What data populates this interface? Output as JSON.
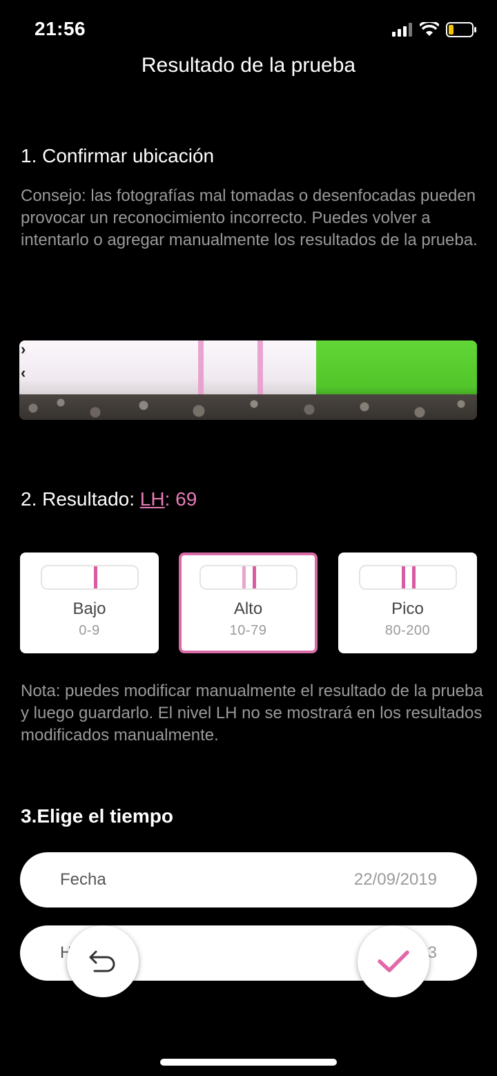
{
  "status_bar": {
    "time": "21:56",
    "signal_icon": "signal-icon",
    "wifi_icon": "wifi-icon",
    "battery_icon": "battery-icon",
    "battery_color": "#f5c400"
  },
  "header": {
    "title": "Resultado de la prueba"
  },
  "step1": {
    "title": "1. Confirmar ubicación",
    "tip": "Consejo: las fotografías mal tomadas o desenfocadas pueden provocar un reconocimiento incorrecto. Puedes volver a intentarlo o agregar manualmente los resultados de la prueba."
  },
  "step2": {
    "title_prefix": "2. Resultado: ",
    "lh_label": "LH",
    "lh_value": ": 69",
    "accent_color": "#e77bb6",
    "levels": [
      {
        "name": "Bajo",
        "range": "0-9",
        "selected": false,
        "lines": 1
      },
      {
        "name": "Alto",
        "range": "10-79",
        "selected": true,
        "lines": 2
      },
      {
        "name": "Pico",
        "range": "80-200",
        "selected": false,
        "lines": 2
      }
    ],
    "note": "Nota: puedes modificar manualmente el resultado de la prueba y luego guardarlo. El nivel LH no se mostrará en los resultados modificados manualmente."
  },
  "step3": {
    "title": "3.Elige el tiempo",
    "date_label": "Fecha",
    "date_value": "22/09/2019",
    "hour_label_partial": "H",
    "hour_value_partial": "3"
  },
  "actions": {
    "back_icon": "undo-arrow-icon",
    "confirm_icon": "checkmark-icon"
  }
}
